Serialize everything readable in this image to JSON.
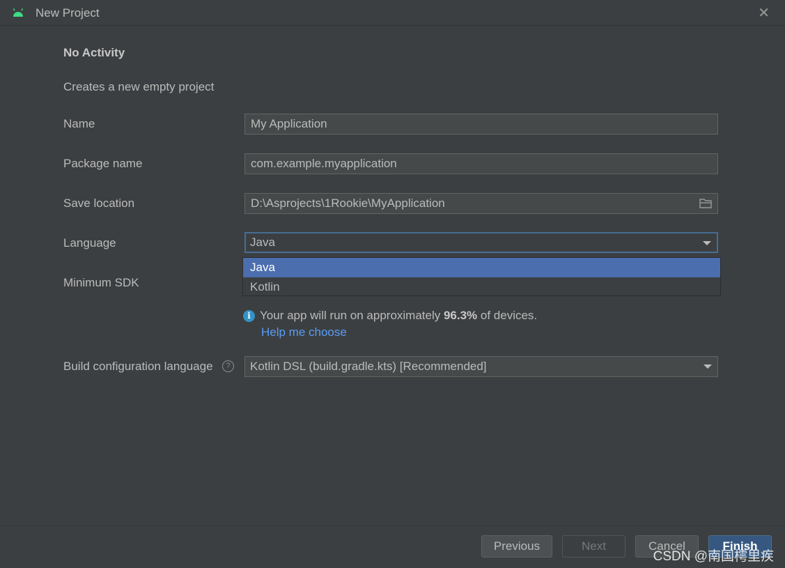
{
  "window": {
    "title": "New Project",
    "close_icon": "close-icon"
  },
  "page": {
    "heading": "No Activity",
    "description": "Creates a new empty project"
  },
  "form": {
    "name_label": "Name",
    "name_value": "My Application",
    "package_label": "Package name",
    "package_value": "com.example.myapplication",
    "save_label": "Save location",
    "save_value": "D:\\Asprojects\\1Rookie\\MyApplication",
    "language_label": "Language",
    "language_value": "Java",
    "language_options": [
      "Java",
      "Kotlin"
    ],
    "min_sdk_label": "Minimum SDK",
    "info_prefix": "Your app will run on approximately ",
    "info_percent": "96.3%",
    "info_suffix": " of devices.",
    "help_link": "Help me choose",
    "build_label": "Build configuration language",
    "build_value": "Kotlin DSL (build.gradle.kts) [Recommended]"
  },
  "footer": {
    "previous": "Previous",
    "next": "Next",
    "cancel": "Cancel",
    "finish": "Finish"
  },
  "watermark": "CSDN @南国樗里疾",
  "colors": {
    "accent": "#4b6eaf",
    "link": "#589df6",
    "info": "#3592c4",
    "android": "#3ddc84"
  }
}
